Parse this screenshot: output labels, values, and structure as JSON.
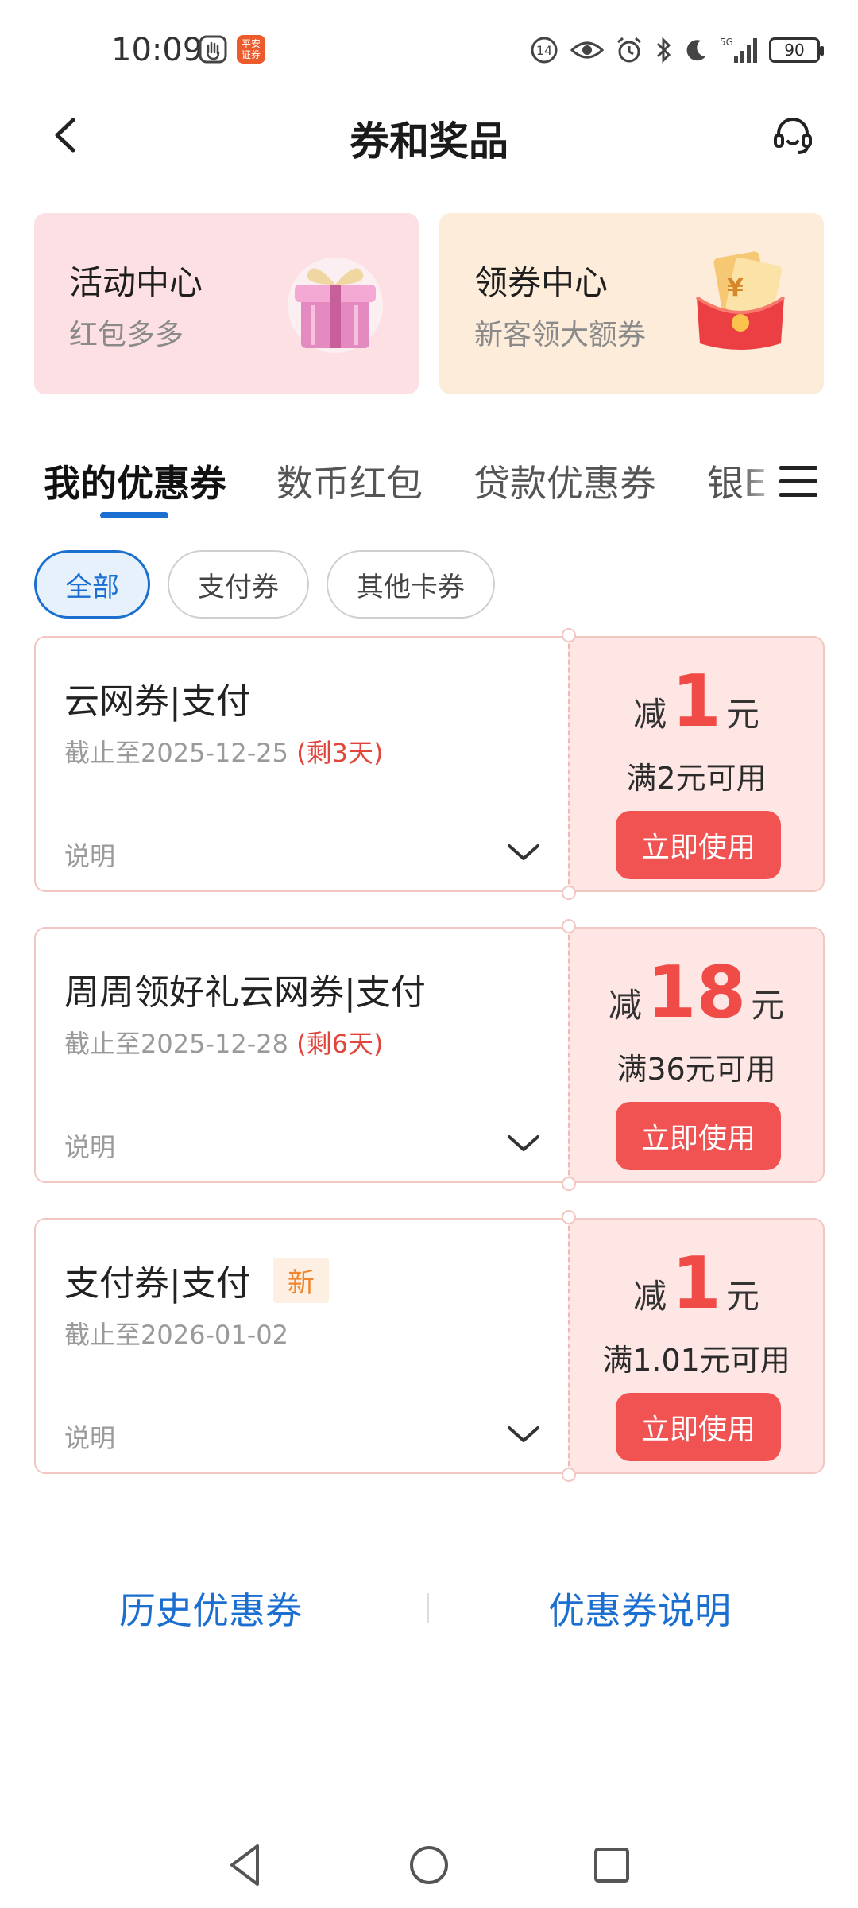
{
  "status_bar": {
    "time": "10:09",
    "app_badge": "平安\n证券",
    "network": "5G",
    "battery": "90"
  },
  "header": {
    "title": "券和奖品"
  },
  "promos": [
    {
      "title": "活动中心",
      "subtitle": "红包多多"
    },
    {
      "title": "领券中心",
      "subtitle": "新客领大额券"
    }
  ],
  "tabs": [
    {
      "label": "我的优惠券",
      "active": true
    },
    {
      "label": "数币红包"
    },
    {
      "label": "贷款优惠券"
    },
    {
      "label": "银E"
    }
  ],
  "filters": [
    {
      "label": "全部",
      "active": true
    },
    {
      "label": "支付券"
    },
    {
      "label": "其他卡券"
    }
  ],
  "coupons": [
    {
      "name": "云网券|支付",
      "expiry": "截止至2025-12-25",
      "remaining": "(剩3天)",
      "desc": "说明",
      "prefix": "减",
      "amount": "1",
      "unit": "元",
      "condition": "满2元可用",
      "button": "立即使用"
    },
    {
      "name": "周周领好礼云网券|支付",
      "expiry": "截止至2025-12-28",
      "remaining": "(剩6天)",
      "desc": "说明",
      "prefix": "减",
      "amount": "18",
      "unit": "元",
      "condition": "满36元可用",
      "button": "立即使用"
    },
    {
      "name": "支付券|支付",
      "tag": "新",
      "expiry": "截止至2026-01-02",
      "desc": "说明",
      "prefix": "减",
      "amount": "1",
      "unit": "元",
      "condition": "满1.01元可用",
      "button": "立即使用"
    }
  ],
  "footer_links": {
    "history": "历史优惠券",
    "explain": "优惠券说明"
  },
  "colors": {
    "accent": "#1a6fd0",
    "coupon_red": "#f04b47",
    "button_red": "#f15352"
  }
}
